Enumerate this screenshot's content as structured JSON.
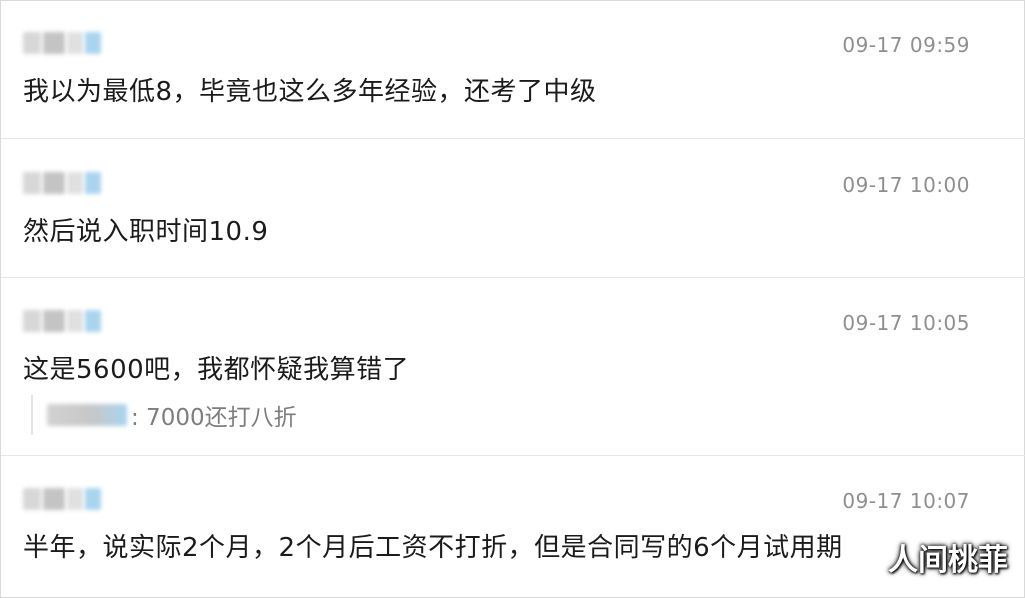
{
  "comments": [
    {
      "timestamp": "09-17 09:59",
      "text": "我以为最低8，毕竟也这么多年经验，还考了中级"
    },
    {
      "timestamp": "09-17 10:00",
      "text": "然后说入职时间10.9"
    },
    {
      "timestamp": "09-17 10:05",
      "text": "这是5600吧，我都怀疑我算错了",
      "reply": {
        "text": ": 7000还打八折"
      }
    },
    {
      "timestamp": "09-17 10:07",
      "text": "半年，说实际2个月，2个月后工资不打折，但是合同写的6个月试用期"
    }
  ],
  "watermark": "人间桃菲",
  "colors": {
    "timestamp": "#8f8f8f",
    "text": "#1b1b1b",
    "reply_text": "#7d7d7d",
    "divider": "#e6e6e6",
    "avatar_accent": "#a9d4ef"
  }
}
